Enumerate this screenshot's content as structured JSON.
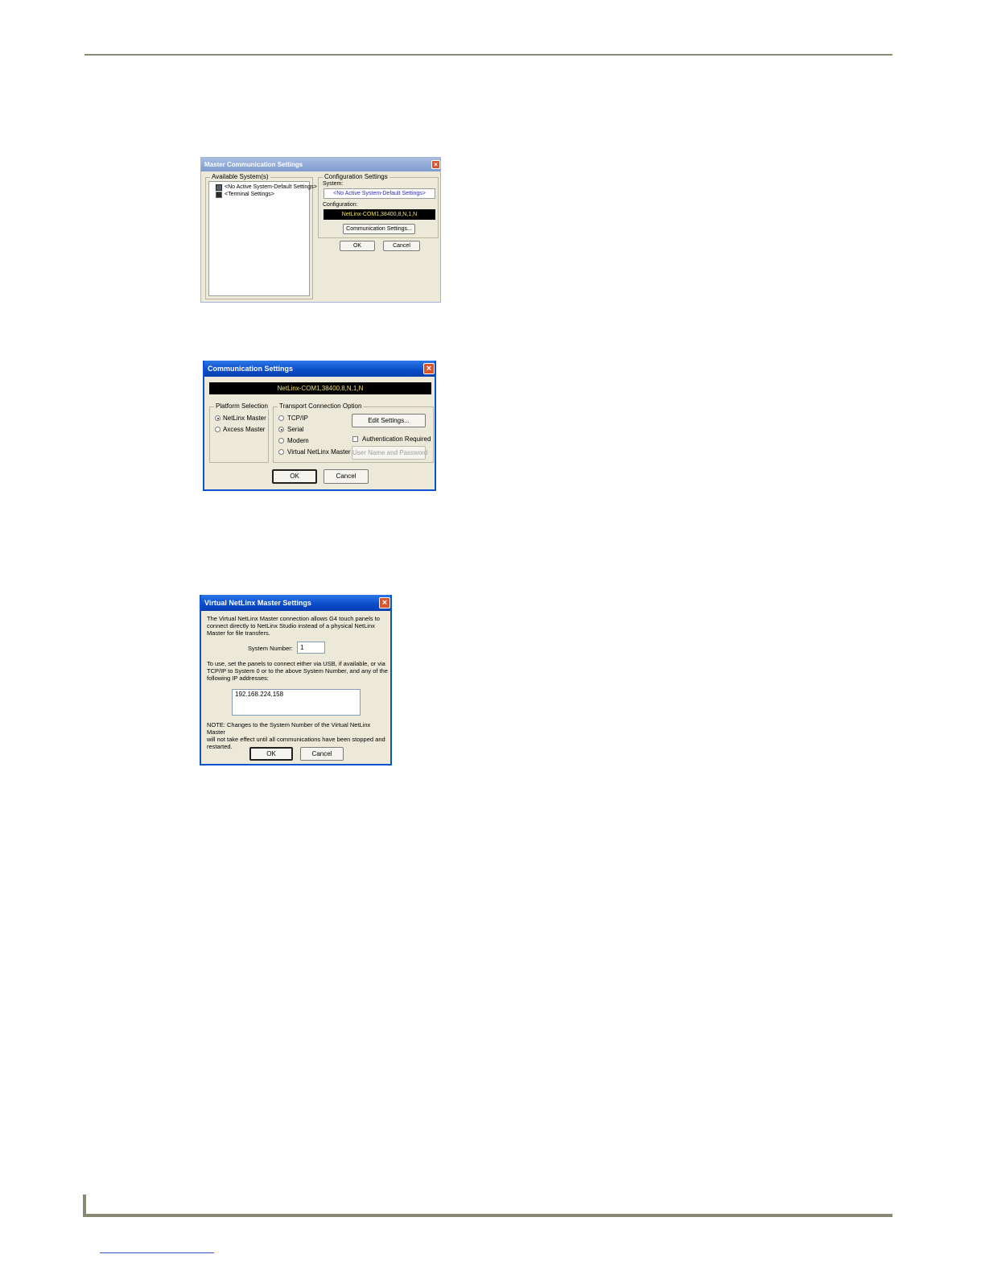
{
  "dialog1": {
    "title": "Master Communication Settings",
    "available_systems_label": "Available System(s)",
    "tree_items": [
      {
        "icon": "system-icon",
        "label": "<No Active System-Default Settings>"
      },
      {
        "icon": "terminal-icon",
        "label": "<Terminal Settings>"
      }
    ],
    "configuration_settings_label": "Configuration Settings",
    "system_label": "System:",
    "system_value": "<No Active System-Default Settings>",
    "configuration_label": "Configuration:",
    "configuration_value": "NetLinx-COM1,38400,8,N,1,N",
    "communication_settings_button": "Communication Settings...",
    "ok_button": "OK",
    "cancel_button": "Cancel"
  },
  "dialog2": {
    "title": "Communication Settings",
    "status_value": "NetLinx-COM1,38400,8,N,1,N",
    "platform_selection_label": "Platform Selection",
    "platform_options": [
      {
        "label": "NetLinx Master",
        "selected": true
      },
      {
        "label": "Axcess Master",
        "selected": false
      }
    ],
    "transport_label": "Transport Connection Option",
    "transport_options": [
      {
        "label": "TCP/IP",
        "selected": false
      },
      {
        "label": "Serial",
        "selected": true
      },
      {
        "label": "Modem",
        "selected": false
      },
      {
        "label": "Virtual NetLinx Master",
        "selected": false
      }
    ],
    "edit_settings_button": "Edit Settings...",
    "authentication_label": "Authentication Required",
    "user_name_password_button": "User Name and Password",
    "ok_button": "OK",
    "cancel_button": "Cancel"
  },
  "dialog3": {
    "title": "Virtual NetLinx Master Settings",
    "intro_lines": [
      "The Virtual NetLinx Master connection allows G4 touch panels to",
      "connect directly to NetLinx Studio instead of a physical NetLinx",
      "Master for file transfers."
    ],
    "system_number_label": "System Number:",
    "system_number_value": "1",
    "instructions_lines": [
      "To use, set the panels to connect either via USB, if available, or via",
      "TCP/IP to System 0 or to the above System Number, and any of the",
      "following IP addresses:"
    ],
    "ip_addresses": [
      "192.168.224.158"
    ],
    "note_lines": [
      "NOTE: Changes to the System Number of the Virtual NetLinx Master",
      "will not take effect until all communications have been stopped and",
      "restarted."
    ],
    "ok_button": "OK",
    "cancel_button": "Cancel"
  },
  "colors": {
    "dialog_face": "#ece9d8",
    "xp_title_blue": "#0a52d0",
    "status_black": "#000000",
    "status_yellow": "#f0e060",
    "link_blue": "#3355cc"
  }
}
